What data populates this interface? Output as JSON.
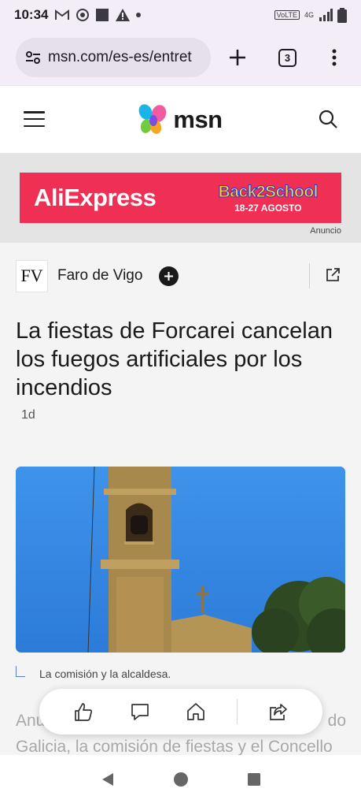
{
  "status_bar": {
    "time": "10:34",
    "network_label": "VoLTE",
    "network_type": "4G",
    "icons": [
      "gmail-icon",
      "focus-icon",
      "square-notification-icon",
      "warning-icon",
      "dot-icon",
      "signal-icon",
      "battery-icon"
    ]
  },
  "browser": {
    "url": "msn.com/es-es/entret",
    "tab_count": "3",
    "icons": [
      "site-settings-icon",
      "new-tab-icon",
      "tab-switcher-icon",
      "more-menu-icon"
    ]
  },
  "header": {
    "logo_text": "msn",
    "icons": [
      "menu-icon",
      "msn-logo-icon",
      "search-icon"
    ]
  },
  "ad": {
    "brand": "AliExpress",
    "promo": "Back2School",
    "dates": "18-27 AGOSTO",
    "label": "Anuncio"
  },
  "article": {
    "source_logo": "FV",
    "source_name": "Faro de Vigo",
    "title": "La fiestas de Forcarei cancelan los fuegos artificiales por los incendios",
    "time_ago": "1d",
    "caption": "La comisión y la alcaldesa.",
    "body_line1_start": "Anu",
    "body_line1_end": "do",
    "body_line2": "Galicia, la comisión de fiestas y el Concello"
  },
  "action_bar": {
    "icons": [
      "like-icon",
      "comment-icon",
      "home-icon",
      "share-icon"
    ]
  },
  "nav_bar": {
    "icons": [
      "back-icon",
      "home-circle-icon",
      "recents-icon"
    ]
  },
  "colors": {
    "browser_bg": "#f3edf7",
    "ad_red": "#ef2f54",
    "article_bg": "#f4f4f4"
  }
}
